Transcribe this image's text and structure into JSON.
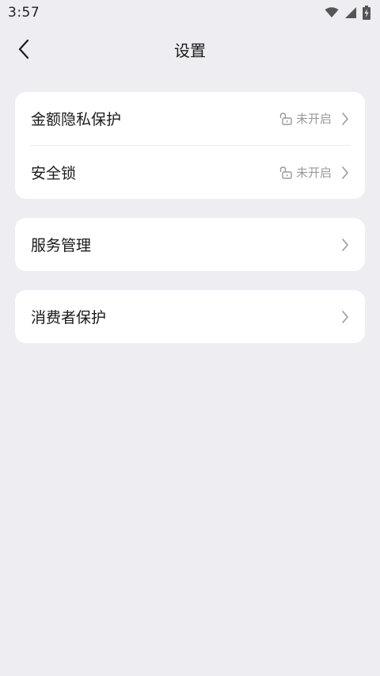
{
  "status_bar": {
    "time": "3:57",
    "icons": [
      "wifi-icon",
      "cellular-signal-icon",
      "battery-charging-icon"
    ]
  },
  "nav": {
    "back_icon": "chevron-left-icon",
    "title": "设置"
  },
  "sections": [
    {
      "items": [
        {
          "label": "金额隐私保护",
          "state": "未开启",
          "state_icon": "unlock-icon",
          "chevron": "chevron-right-icon"
        },
        {
          "label": "安全锁",
          "state": "未开启",
          "state_icon": "unlock-icon",
          "chevron": "chevron-right-icon"
        }
      ]
    },
    {
      "items": [
        {
          "label": "服务管理",
          "chevron": "chevron-right-icon"
        }
      ]
    },
    {
      "items": [
        {
          "label": "消费者保护",
          "chevron": "chevron-right-icon"
        }
      ]
    }
  ],
  "colors": {
    "background": "#eeedf2",
    "card": "#ffffff",
    "text": "#1a1a1a",
    "muted": "#9a9a9a"
  }
}
